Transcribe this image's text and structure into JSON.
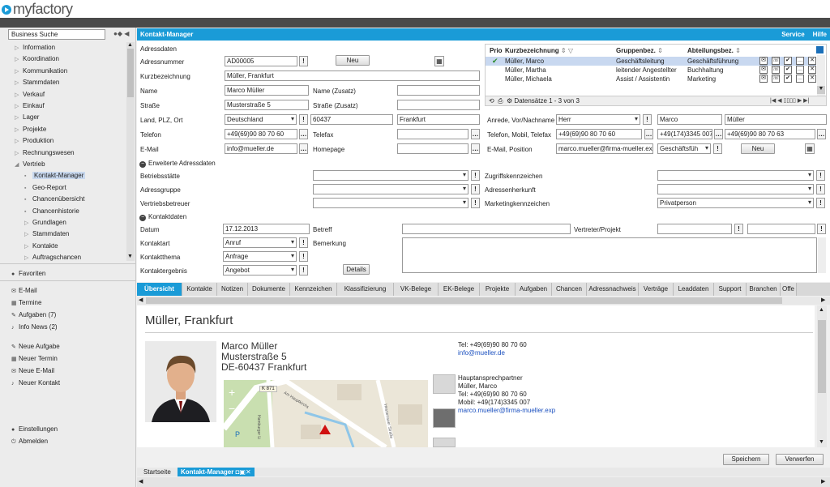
{
  "app": {
    "logo": "myfactory"
  },
  "sidebar": {
    "search_value": "Business Suche",
    "tree": [
      {
        "label": "Information",
        "expanded": false
      },
      {
        "label": "Koordination",
        "expanded": false
      },
      {
        "label": "Kommunikation",
        "expanded": false
      },
      {
        "label": "Stammdaten",
        "expanded": false
      },
      {
        "label": "Verkauf",
        "expanded": false
      },
      {
        "label": "Einkauf",
        "expanded": false
      },
      {
        "label": "Lager",
        "expanded": false
      },
      {
        "label": "Projekte",
        "expanded": false
      },
      {
        "label": "Produktion",
        "expanded": false
      },
      {
        "label": "Rechnungswesen",
        "expanded": false
      },
      {
        "label": "Vertrieb",
        "expanded": true
      }
    ],
    "vertrieb_children": [
      {
        "label": "Kontakt-Manager",
        "selected": true
      },
      {
        "label": "Geo-Report"
      },
      {
        "label": "Chancenübersicht"
      },
      {
        "label": "Chancenhistorie"
      },
      {
        "label": "Grundlagen",
        "folder": true
      },
      {
        "label": "Stammdaten",
        "folder": true
      },
      {
        "label": "Kontakte",
        "folder": true
      },
      {
        "label": "Auftragschancen",
        "folder": true
      }
    ],
    "favoriten": "Favoriten",
    "items1": [
      "E-Mail",
      "Termine",
      "Aufgaben (7)",
      "Info News (2)"
    ],
    "items2": [
      "Neue Aufgabe",
      "Neuer Termin",
      "Neue E-Mail",
      "Neuer Kontakt"
    ],
    "einstellungen": "Einstellungen",
    "abmelden": "Abmelden"
  },
  "header": {
    "title": "Kontakt-Manager",
    "service": "Service",
    "hilfe": "Hilfe"
  },
  "form": {
    "section_adress": "Adressdaten",
    "adressnummer_label": "Adressnummer",
    "adressnummer": "AD00005",
    "neu_label": "Neu",
    "kurzbez_label": "Kurzbezeichnung",
    "kurzbez": "Müller, Frankfurt",
    "name_label": "Name",
    "name": "Marco Müller",
    "name_zusatz_label": "Name (Zusatz)",
    "strasse_label": "Straße",
    "strasse": "Musterstraße 5",
    "strasse_zusatz_label": "Straße (Zusatz)",
    "land_label": "Land, PLZ, Ort",
    "land": "Deutschland",
    "plz": "60437",
    "ort": "Frankfurt",
    "telefon_label": "Telefon",
    "telefon": "+49(69)90 80 70 60",
    "telefax_label": "Telefax",
    "email_label": "E-Mail",
    "email": "info@mueller.de",
    "homepage_label": "Homepage",
    "section_erweitert": "Erweiterte Adressdaten",
    "betriebsstaette_label": "Betriebsstätte",
    "adressgruppe_label": "Adressgruppe",
    "vertriebsbetreuer_label": "Vertriebsbetreuer",
    "zugriff_label": "Zugriffskennzeichen",
    "adressherkunft_label": "Adressenherkunft",
    "marketing_label": "Marketingkennzeichen",
    "marketing": "Privatperson",
    "section_kontakt": "Kontaktdaten",
    "datum_label": "Datum",
    "datum": "17.12.2013",
    "betreff_label": "Betreff",
    "vertreter_label": "Vertreter/Projekt",
    "kontaktart_label": "Kontaktart",
    "kontaktart": "Anruf",
    "bemerkung_label": "Bemerkung",
    "kontaktthema_label": "Kontaktthema",
    "kontaktthema": "Anfrage",
    "kontaktergebnis_label": "Kontaktergebnis",
    "kontaktergebnis": "Angebot",
    "details_label": "Details"
  },
  "grid": {
    "headers": [
      "Prio",
      "Kurzbezeichnung",
      "Gruppenbez.",
      "Abteilungsbez."
    ],
    "rows": [
      {
        "name": "Müller, Marco",
        "gruppe": "Geschäftsleitung",
        "abteilung": "Geschäftsführung",
        "checked": true
      },
      {
        "name": "Müller, Martha",
        "gruppe": "leitender Angestellter",
        "abteilung": "Buchhaltung",
        "checked": false
      },
      {
        "name": "Müller, Michaela",
        "gruppe": "Assist / Assistentin",
        "abteilung": "Marketing",
        "checked": false
      }
    ],
    "datensaetze": "Datensätze 1 - 3 von 3"
  },
  "ansprech": {
    "anrede_label": "Anrede, Vor/Nachname",
    "anrede": "Herr",
    "vorname": "Marco",
    "nachname": "Müller",
    "telefon_label": "Telefon, Mobil, Telefax",
    "telefon": "+49(69)90 80 70 60",
    "mobil": "+49(174)3345 007",
    "telefax": "+49(69)90 80 70 63",
    "email_label": "E-Mail, Position",
    "email": "marco.mueller@firma-mueller.exp",
    "position": "Geschäftsfüh",
    "neu_label": "Neu"
  },
  "tabs": [
    "Übersicht",
    "Kontakte",
    "Notizen",
    "Dokumente",
    "Kennzeichen",
    "Klassifizierung",
    "VK-Belege",
    "EK-Belege",
    "Projekte",
    "Aufgaben",
    "Chancen",
    "Adressnachweis",
    "Verträge",
    "Leaddaten",
    "Support",
    "Branchen",
    "Offe"
  ],
  "detail": {
    "title": "Müller, Frankfurt",
    "name": "Marco Müller",
    "strasse": "Musterstraße 5",
    "ort": "DE-60437 Frankfurt",
    "tel": "Tel: +49(69)90 80 70 60",
    "email": "info@mueller.de",
    "haupt_label": "Hauptansprechpartner",
    "haupt_name": "Müller, Marco",
    "haupt_tel": "Tel: +49(69)90 80 70 60",
    "haupt_mobil": "Mobil: +49(174)3345 007",
    "haupt_email": "marco.mueller@firma-mueller.exp",
    "map_labels": [
      "K 871",
      "Am Hauptkirchs",
      "Hamburger Li",
      "Hessenauer Straße"
    ]
  },
  "bottom": {
    "speichern": "Speichern",
    "verwerfen": "Verwerfen",
    "tab1": "Startseite",
    "tab2": "Kontakt-Manager"
  },
  "colors": {
    "accent": "#1a9bd7",
    "dark": "#4a4a4a"
  }
}
